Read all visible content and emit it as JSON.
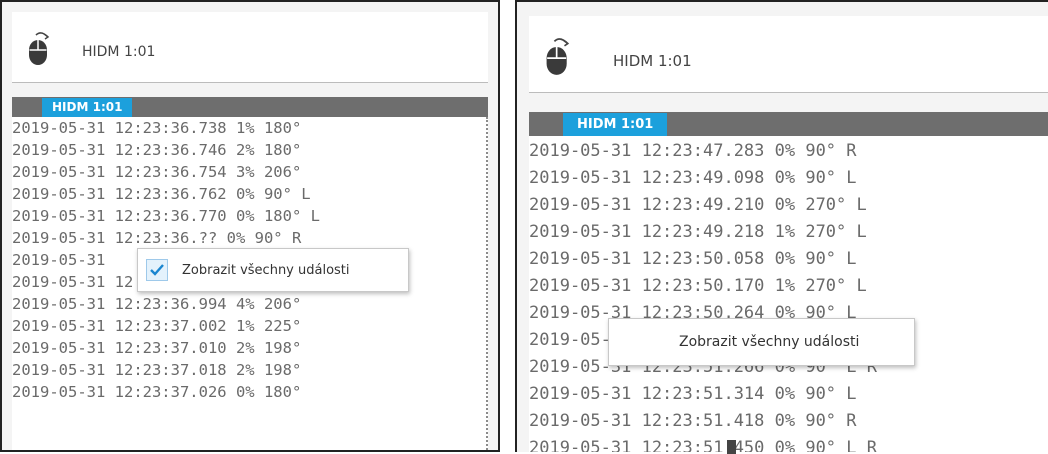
{
  "left_panel": {
    "header_title": "HIDM 1:01",
    "header_icon": "mouse-icon",
    "tab_label": "HIDM 1:01",
    "lines": [
      "2019-05-31 12:23:36.738 1% 180°",
      "2019-05-31 12:23:36.746 2% 180°",
      "2019-05-31 12:23:36.754 3% 206°",
      "2019-05-31 12:23:36.762 0% 90° L",
      "2019-05-31 12:23:36.770 0% 180° L",
      "2019-05-31 12:23:36.?? 0% 90° R",
      "2019-05-31",
      "2019-05-31 12:23:36.890 0% 90°",
      "2019-05-31 12:23:36.994 4% 206°",
      "2019-05-31 12:23:37.002 1% 225°",
      "2019-05-31 12:23:37.010 2% 198°",
      "2019-05-31 12:23:37.018 2% 198°",
      "2019-05-31 12:23:37.026 0% 180°"
    ],
    "context_menu": {
      "label": "Zobrazit všechny události",
      "checked": true,
      "check_icon": "checkmark-icon"
    }
  },
  "right_panel": {
    "header_title": "HIDM 1:01",
    "header_icon": "mouse-icon",
    "tab_label": "HIDM 1:01",
    "lines": [
      "2019-05-31 12:23:47.283 0% 90° R",
      "2019-05-31 12:23:49.098 0% 90° L",
      "2019-05-31 12:23:49.210 0% 270° L",
      "2019-05-31 12:23:49.218 1% 270° L",
      "2019-05-31 12:23:50.058 0% 90° L",
      "2019-05-31 12:23:50.170 1% 270° L",
      "2019-05-31 12:23:50.264 0% 90° L",
      "2019-05-31 12:23:50.290 0% 90° L",
      "2019-05-31 12:23:51.266 0% 90° L R",
      "2019-05-31 12:23:51.314 0% 90° L",
      "2019-05-31 12:23:51.418 0% 90° R",
      "2019-05-31 12:23:51.450 0% 90° L R"
    ],
    "context_menu": {
      "label": "Zobrazit všechny události",
      "checked": false
    }
  },
  "colors": {
    "tab_blue": "#1ca0dc",
    "bar_gray": "#6e6e6e",
    "log_text": "#6a6a6a",
    "check_blue": "#1a86d0"
  }
}
